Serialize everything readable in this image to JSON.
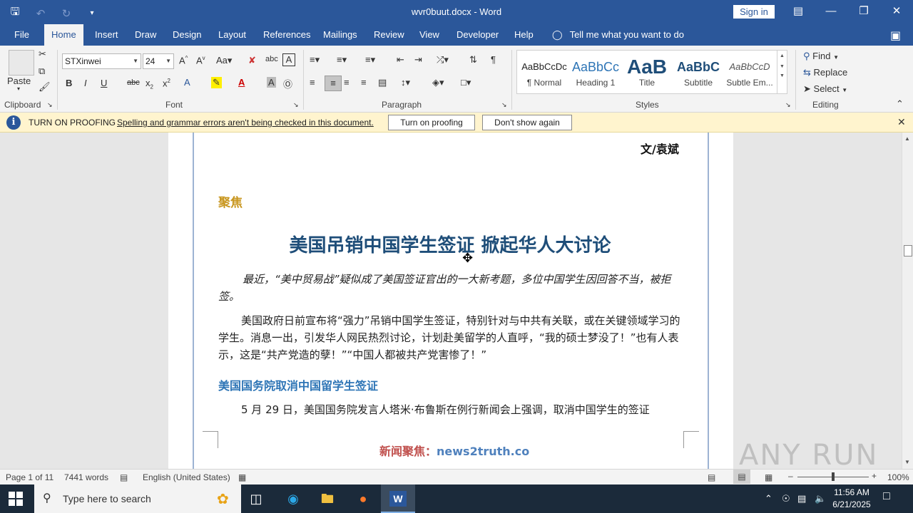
{
  "window": {
    "doc_title": "wvr0buut.docx  -  Word",
    "signin_label": "Sign in"
  },
  "ribbon_tabs": [
    {
      "label": "File"
    },
    {
      "label": "Home"
    },
    {
      "label": "Insert"
    },
    {
      "label": "Draw"
    },
    {
      "label": "Design"
    },
    {
      "label": "Layout"
    },
    {
      "label": "References"
    },
    {
      "label": "Mailings"
    },
    {
      "label": "Review"
    },
    {
      "label": "View"
    },
    {
      "label": "Developer"
    },
    {
      "label": "Help"
    }
  ],
  "active_tab": "Home",
  "tell_me": "Tell me what you want to do",
  "clipboard": {
    "paste_label": "Paste",
    "group_label": "Clipboard"
  },
  "font": {
    "name": "STXinwei",
    "size": "24",
    "group_label": "Font"
  },
  "paragraph": {
    "group_label": "Paragraph"
  },
  "styles": {
    "group_label": "Styles",
    "items": [
      {
        "sample": "AaBbCcDc",
        "name": "¶ Normal"
      },
      {
        "sample": "AaBbCc",
        "name": "Heading 1"
      },
      {
        "sample": "AaB",
        "name": "Title"
      },
      {
        "sample": "AaBbC",
        "name": "Subtitle"
      },
      {
        "sample": "AaBbCcD",
        "name": "Subtle Em..."
      }
    ]
  },
  "editing": {
    "group_label": "Editing",
    "find": "Find",
    "replace": "Replace",
    "select": "Select"
  },
  "notification": {
    "title": "TURN ON PROOFING",
    "message": "Spelling and grammar errors aren't being checked in this document.",
    "btn_turn_on": "Turn on proofing",
    "btn_dont_show": "Don't show again"
  },
  "document": {
    "author": "文/袁斌",
    "section_tag": "聚焦",
    "headline": "美国吊销中国学生签证 掀起华人大讨论",
    "lead": "最近，“美中贸易战”疑似成了美国签证官出的一大新考题，多位中国学生因回答不当，被拒签。",
    "para1": "美国政府日前宣布将“强力”吊销中国学生签证，特别针对与中共有关联，或在关键领域学习的学生。消息一出，引发华人网民热烈讨论，计划赴美留学的人直呼，“我的硕士梦没了！”也有人表示，这是“共产党造的孽！”“中国人都被共产党害惨了！”",
    "subhead": "美国国务院取消中国留学生签证",
    "para2": "5 月 29 日，美国国务院发言人塔米·布鲁斯在例行新闻会上强调，取消中国学生的签证",
    "footer_cn": "新闻聚焦：",
    "footer_en": "news2truth.co"
  },
  "status": {
    "page": "Page 1 of 11",
    "words": "7441 words",
    "language": "English (United States)",
    "zoom": "100%"
  },
  "taskbar": {
    "search_placeholder": "Type here to search",
    "time": "11:56 AM",
    "date": "6/21/2025"
  },
  "watermark": "ANY RUN",
  "colors": {
    "word_blue": "#2b579a",
    "headline": "#1f4e79",
    "section_tag": "#c8961e",
    "subhead": "#2e75b6",
    "notify_bg": "#fff4ce"
  }
}
